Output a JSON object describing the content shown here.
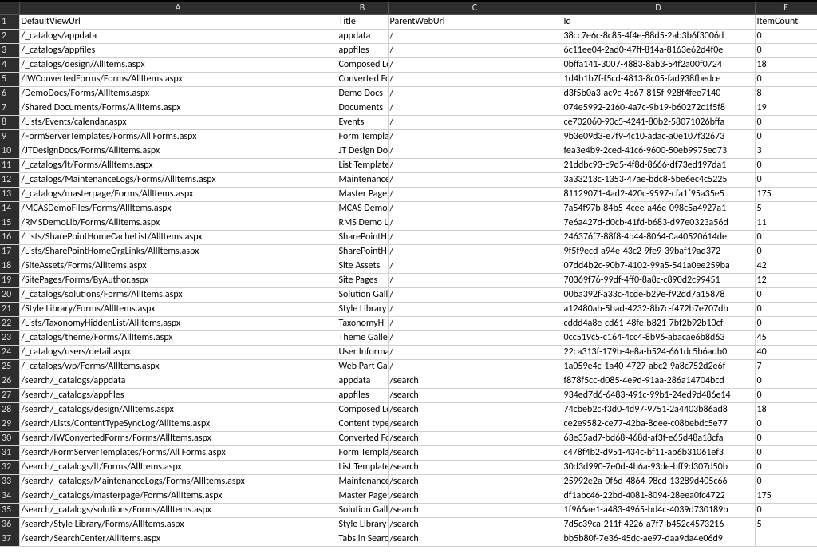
{
  "columns": {
    "corner": "",
    "letters": [
      "A",
      "B",
      "C",
      "D",
      "E"
    ],
    "headers": [
      "DefaultViewUrl",
      "Title",
      "ParentWebUrl",
      "Id",
      "ItemCount"
    ]
  },
  "rows": [
    {
      "n": 1
    },
    {
      "n": 2,
      "A": "/_catalogs/appdata",
      "B": "appdata",
      "C": "/",
      "D": "38cc7e6c-8c85-4f4e-88d5-2ab3b6f3006d",
      "E": "0"
    },
    {
      "n": 3,
      "A": "/_catalogs/appfiles",
      "B": "appfiles",
      "C": "/",
      "D": "6c11ee04-2ad0-47ff-814a-8163e62d4f0e",
      "E": "0"
    },
    {
      "n": 4,
      "A": "/_catalogs/design/AllItems.aspx",
      "B": "Composed Lo",
      "C": "/",
      "D": "0bffa141-3007-4883-8ab3-54f2a00f0724",
      "E": "18"
    },
    {
      "n": 5,
      "A": "/IWConvertedForms/Forms/AllItems.aspx",
      "B": "Converted Fo",
      "C": "/",
      "D": "1d4b1b7f-f5cd-4813-8c05-fad938fbedce",
      "E": "0"
    },
    {
      "n": 6,
      "A": "/DemoDocs/Forms/AllItems.aspx",
      "B": "Demo Docs",
      "C": "/",
      "D": "d3f5b0a3-ac9c-4b67-815f-928f4fee7140",
      "E": "8"
    },
    {
      "n": 7,
      "A": "/Shared Documents/Forms/AllItems.aspx",
      "B": "Documents",
      "C": "/",
      "D": "074e5992-2160-4a7c-9b19-b60272c1f5f8",
      "E": "19"
    },
    {
      "n": 8,
      "A": "/Lists/Events/calendar.aspx",
      "B": "Events",
      "C": "/",
      "D": "ce702060-90c5-4241-80b2-58071026bffa",
      "E": "0"
    },
    {
      "n": 9,
      "A": "/FormServerTemplates/Forms/All Forms.aspx",
      "B": "Form Templa",
      "C": "/",
      "D": "9b3e09d3-e7f9-4c10-adac-a0e107f32673",
      "E": "0"
    },
    {
      "n": 10,
      "A": "/JTDesignDocs/Forms/AllItems.aspx",
      "B": "JT Design Do",
      "C": "/",
      "D": "fea3e4b9-2ced-41c6-9600-50eb9975ed73",
      "E": "3"
    },
    {
      "n": 11,
      "A": "/_catalogs/lt/Forms/AllItems.aspx",
      "B": "List Template",
      "C": "/",
      "D": "21ddbc93-c9d5-4f8d-8666-df73ed197da1",
      "E": "0"
    },
    {
      "n": 12,
      "A": "/_catalogs/MaintenanceLogs/Forms/AllItems.aspx",
      "B": "Maintenance",
      "C": "/",
      "D": "3a33213c-1353-47ae-bdc8-5be6ec4c5225",
      "E": "0"
    },
    {
      "n": 13,
      "A": "/_catalogs/masterpage/Forms/AllItems.aspx",
      "B": "Master Page",
      "C": "/",
      "D": "81129071-4ad2-420c-9597-cfa1f95a35e5",
      "E": "175"
    },
    {
      "n": 14,
      "A": "/MCASDemoFiles/Forms/AllItems.aspx",
      "B": "MCAS Demo",
      "C": "/",
      "D": "7a54f97b-84b5-4cee-a46e-098c5a4927a1",
      "E": "5"
    },
    {
      "n": 15,
      "A": "/RMSDemoLib/Forms/AllItems.aspx",
      "B": "RMS Demo L",
      "C": "/",
      "D": "7e6a427d-d0cb-41fd-b683-d97e0323a56d",
      "E": "11"
    },
    {
      "n": 16,
      "A": "/Lists/SharePointHomeCacheList/AllItems.aspx",
      "B": "SharePointH",
      "C": "/",
      "D": "246376f7-88f8-4b44-8064-0a40520614de",
      "E": "0"
    },
    {
      "n": 17,
      "A": "/Lists/SharePointHomeOrgLinks/AllItems.aspx",
      "B": "SharePointH",
      "C": "/",
      "D": "9f5f9ecd-a94e-43c2-9fe9-39baf19ad372",
      "E": "0"
    },
    {
      "n": 18,
      "A": "/SiteAssets/Forms/AllItems.aspx",
      "B": "Site Assets",
      "C": "/",
      "D": "07dd4b2c-90b7-4102-99a5-541a0ee259ba",
      "E": "42"
    },
    {
      "n": 19,
      "A": "/SitePages/Forms/ByAuthor.aspx",
      "B": "Site Pages",
      "C": "/",
      "D": "70369f76-99df-4ff0-8a8c-c890d2c99451",
      "E": "12"
    },
    {
      "n": 20,
      "A": "/_catalogs/solutions/Forms/AllItems.aspx",
      "B": "Solution Gall",
      "C": "/",
      "D": "00ba392f-a33c-4cde-b29e-f92dd7a15878",
      "E": "0"
    },
    {
      "n": 21,
      "A": "/Style Library/Forms/AllItems.aspx",
      "B": "Style Library",
      "C": "/",
      "D": "a12480ab-5bad-4232-8b7c-f472b7e707db",
      "E": "0"
    },
    {
      "n": 22,
      "A": "/Lists/TaxonomyHiddenList/AllItems.aspx",
      "B": "TaxonomyHi",
      "C": "/",
      "D": "cddd4a8e-cd61-48fe-b821-7bf2b92b10cf",
      "E": "0"
    },
    {
      "n": 23,
      "A": "/_catalogs/theme/Forms/AllItems.aspx",
      "B": "Theme Galle",
      "C": "/",
      "D": "0cc519c5-c164-4cc4-8b96-abacae6b8d63",
      "E": "45"
    },
    {
      "n": 24,
      "A": "/_catalogs/users/detail.aspx",
      "B": "User Informa",
      "C": "/",
      "D": "22ca313f-179b-4e8a-b524-661dc5b6adb0",
      "E": "40"
    },
    {
      "n": 25,
      "A": "/_catalogs/wp/Forms/AllItems.aspx",
      "B": "Web Part Ga",
      "C": "/",
      "D": "1a059e4c-1a40-4727-abc2-9a8c752d2e6f",
      "E": "7"
    },
    {
      "n": 26,
      "A": "/search/_catalogs/appdata",
      "B": "appdata",
      "C": "/search",
      "D": "f878f5cc-d085-4e9d-91aa-286a14704bcd",
      "E": "0"
    },
    {
      "n": 27,
      "A": "/search/_catalogs/appfiles",
      "B": "appfiles",
      "C": "/search",
      "D": "934ed7d6-6483-491c-99b1-24ed9d486e14",
      "E": "0"
    },
    {
      "n": 28,
      "A": "/search/_catalogs/design/AllItems.aspx",
      "B": "Composed Lo",
      "C": "/search",
      "D": "74cbeb2c-f3d0-4d97-9751-2a4403b86ad8",
      "E": "18"
    },
    {
      "n": 29,
      "A": "/search/Lists/ContentTypeSyncLog/AllItems.aspx",
      "B": "Content type",
      "C": "/search",
      "D": "ce2e9582-ce77-42ba-8dee-c08bebdc5e77",
      "E": "0"
    },
    {
      "n": 30,
      "A": "/search/IWConvertedForms/Forms/AllItems.aspx",
      "B": "Converted Fo",
      "C": "/search",
      "D": "63e35ad7-bd68-468d-af3f-e65d48a18cfa",
      "E": "0"
    },
    {
      "n": 31,
      "A": "/search/FormServerTemplates/Forms/All Forms.aspx",
      "B": "Form Templa",
      "C": "/search",
      "D": "c478f4b2-d951-434c-bf11-ab6b31061ef3",
      "E": "0"
    },
    {
      "n": 32,
      "A": "/search/_catalogs/lt/Forms/AllItems.aspx",
      "B": "List Template",
      "C": "/search",
      "D": "30d3d990-7e0d-4b6a-93de-bff9d307d50b",
      "E": "0"
    },
    {
      "n": 33,
      "A": "/search/_catalogs/MaintenanceLogs/Forms/AllItems.aspx",
      "B": "Maintenance",
      "C": "/search",
      "D": "25992e2a-0f6d-4864-98cd-13289d405c66",
      "E": "0"
    },
    {
      "n": 34,
      "A": "/search/_catalogs/masterpage/Forms/AllItems.aspx",
      "B": "Master Page",
      "C": "/search",
      "D": "df1abc46-22bd-4081-8094-28eea0fc4722",
      "E": "175"
    },
    {
      "n": 35,
      "A": "/search/_catalogs/solutions/Forms/AllItems.aspx",
      "B": "Solution Gall",
      "C": "/search",
      "D": "1f966ae1-a483-4965-bd4c-4039d730189b",
      "E": "0"
    },
    {
      "n": 36,
      "A": "/search/Style Library/Forms/AllItems.aspx",
      "B": "Style Library",
      "C": "/search",
      "D": "7d5c39ca-211f-4226-a7f7-b452c4573216",
      "E": "5"
    },
    {
      "n": 37,
      "A": "/search/SearchCenter/AllItems.aspx",
      "B": "Tabs in Searc",
      "C": "/search",
      "D": "bb5b80f-7e36-45dc-ae97-daa9da4e06d9",
      "E": ""
    }
  ]
}
